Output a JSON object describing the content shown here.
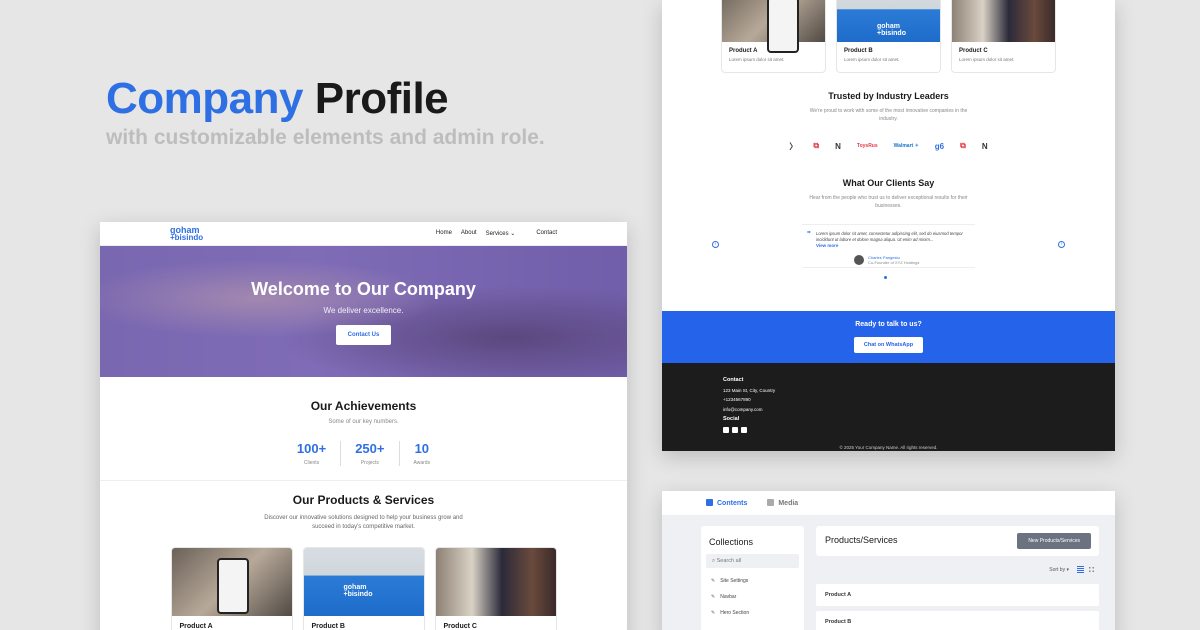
{
  "headline": {
    "accent": "Company",
    "rest": "Profile"
  },
  "subline": "with customizable elements and admin role.",
  "site": {
    "logo_top": "goham",
    "logo_bottom": "+bisindo",
    "nav": {
      "home": "Home",
      "about": "About",
      "services": "Services ⌄",
      "contact": "Contact"
    },
    "hero": {
      "title": "Welcome to Our Company",
      "subtitle": "We deliver excellence.",
      "button": "Contact Us"
    },
    "achievements": {
      "title": "Our Achievements",
      "subtitle": "Some of our key numbers.",
      "stats": [
        {
          "value": "100+",
          "label": "Clients"
        },
        {
          "value": "250+",
          "label": "Projects"
        },
        {
          "value": "10",
          "label": "Awards"
        }
      ]
    },
    "products": {
      "title": "Our Products & Services",
      "subtitle": "Discover our innovative solutions designed to help your business grow and succeed in today's competitive market.",
      "items": [
        {
          "name": "Product A",
          "desc": "Lorem ipsum dolor sit amet."
        },
        {
          "name": "Product B",
          "desc": "Lorem ipsum dolor sit amet."
        },
        {
          "name": "Product C",
          "desc": "Lorem ipsum dolor sit amet."
        }
      ]
    },
    "trusted": {
      "title": "Trusted by Industry Leaders",
      "subtitle": "We're proud to work with some of the most innovative companies in the industry.",
      "logos": [
        "〉",
        "⧉",
        "N",
        "ToysRus",
        "Walmart ✳",
        "ɡ6",
        "⧉",
        "N"
      ]
    },
    "testimonials": {
      "title": "What Our Clients Say",
      "subtitle": "Hear from the people who trust us to deliver exceptional results for their businesses.",
      "quote": "Lorem ipsum dolor sit amet, consectetur adipiscing elit, sed do eiusmod tempor incididunt ut labore et dolore magna aliqua. Ut enim ad minim...",
      "more": "View more",
      "author": "Charles Pangestu",
      "role": "Co-Founder of XYZ Holdings",
      "prev": "‹",
      "next": "›"
    },
    "cta": {
      "title": "Ready to talk to us?",
      "button": "Chat on WhatsApp"
    },
    "footer": {
      "contact_title": "Contact",
      "address": "123 Main St, City, Country",
      "phone": "+1234567890",
      "email": "info@company.com",
      "social_title": "Social",
      "copyright": "© 2025 Your Company Name. All rights reserved."
    }
  },
  "admin": {
    "tabs": {
      "contents": "Contents",
      "media": "Media"
    },
    "sidebar_title": "Collections",
    "search_placeholder": "Search all",
    "collections": [
      "Site Settings",
      "Navbar",
      "Hero Section"
    ],
    "main_title": "Products/Services",
    "new_button": "New Products/Services",
    "sort": "Sort by ▾",
    "rows": [
      "Product A",
      "Product B"
    ]
  },
  "colors": {
    "accent": "#2f6fe4",
    "cta": "#2563eb",
    "footer": "#1c1c1c"
  }
}
